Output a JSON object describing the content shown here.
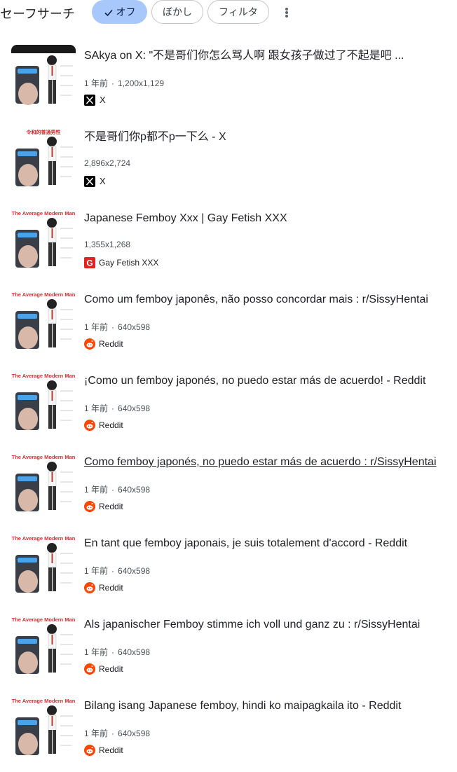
{
  "toolbar": {
    "safe_search_label": "セーフサーチ",
    "chips": {
      "off": "オフ",
      "blur": "ぼかし",
      "filter": "フィルタ"
    }
  },
  "colors": {
    "selected_chip": "#a8c7fa",
    "reddit": "#ff4500",
    "x": "#000000",
    "gay_fetish_xxx": "#e02424"
  },
  "results": [
    {
      "title": "SAkya on X: \"不是哥们你怎么骂人啊 跟女孩子做过了不起是吧 ...",
      "age": "1 年前",
      "dimensions": "1,200x1,129",
      "source": "X",
      "source_icon": "x-logo-icon",
      "thumb_caption": "性经验\n女性经验\n欢宅家\n几把恰恰很满足",
      "thumb_heading": ""
    },
    {
      "title": "不是哥们你p都不p一下么 - X",
      "age": "",
      "dimensions": "2,896x2,724",
      "source": "X",
      "source_icon": "x-logo-icon",
      "thumb_heading": "令和的普通男性"
    },
    {
      "title": "Japanese Femboy Xxx | Gay Fetish XXX",
      "age": "",
      "dimensions": "1,355x1,268",
      "source": "Gay Fetish XXX",
      "source_icon": "gay-fetish-xxx-icon",
      "thumb_heading": "The Average Modern Man"
    },
    {
      "title": "Como um femboy japonês, não posso concordar mais : r/SissyHentai",
      "age": "1 年前",
      "dimensions": "640x598",
      "source": "Reddit",
      "source_icon": "reddit-icon",
      "thumb_heading": "The Average Modern Man"
    },
    {
      "title": "¡Como un femboy japonés, no puedo estar más de acuerdo! - Reddit",
      "age": "1 年前",
      "dimensions": "640x598",
      "source": "Reddit",
      "source_icon": "reddit-icon",
      "thumb_heading": "The Average Modern Man"
    },
    {
      "title": "Como femboy japonés, no puedo estar más de acuerdo : r/SissyHentai",
      "age": "1 年前",
      "dimensions": "640x598",
      "source": "Reddit",
      "source_icon": "reddit-icon",
      "thumb_heading": "The Average Modern Man"
    },
    {
      "title": "En tant que femboy japonais, je suis totalement d'accord - Reddit",
      "age": "1 年前",
      "dimensions": "640x598",
      "source": "Reddit",
      "source_icon": "reddit-icon",
      "thumb_heading": "The Average Modern Man"
    },
    {
      "title": "Als japanischer Femboy stimme ich voll und ganz zu : r/SissyHentai",
      "age": "1 年前",
      "dimensions": "640x598",
      "source": "Reddit",
      "source_icon": "reddit-icon",
      "thumb_heading": "The Average Modern Man"
    },
    {
      "title": "Bilang isang Japanese femboy, hindi ko maipagkaila ito - Reddit",
      "age": "1 年前",
      "dimensions": "640x598",
      "source": "Reddit",
      "source_icon": "reddit-icon",
      "thumb_heading": "The Average Modern Man"
    }
  ]
}
